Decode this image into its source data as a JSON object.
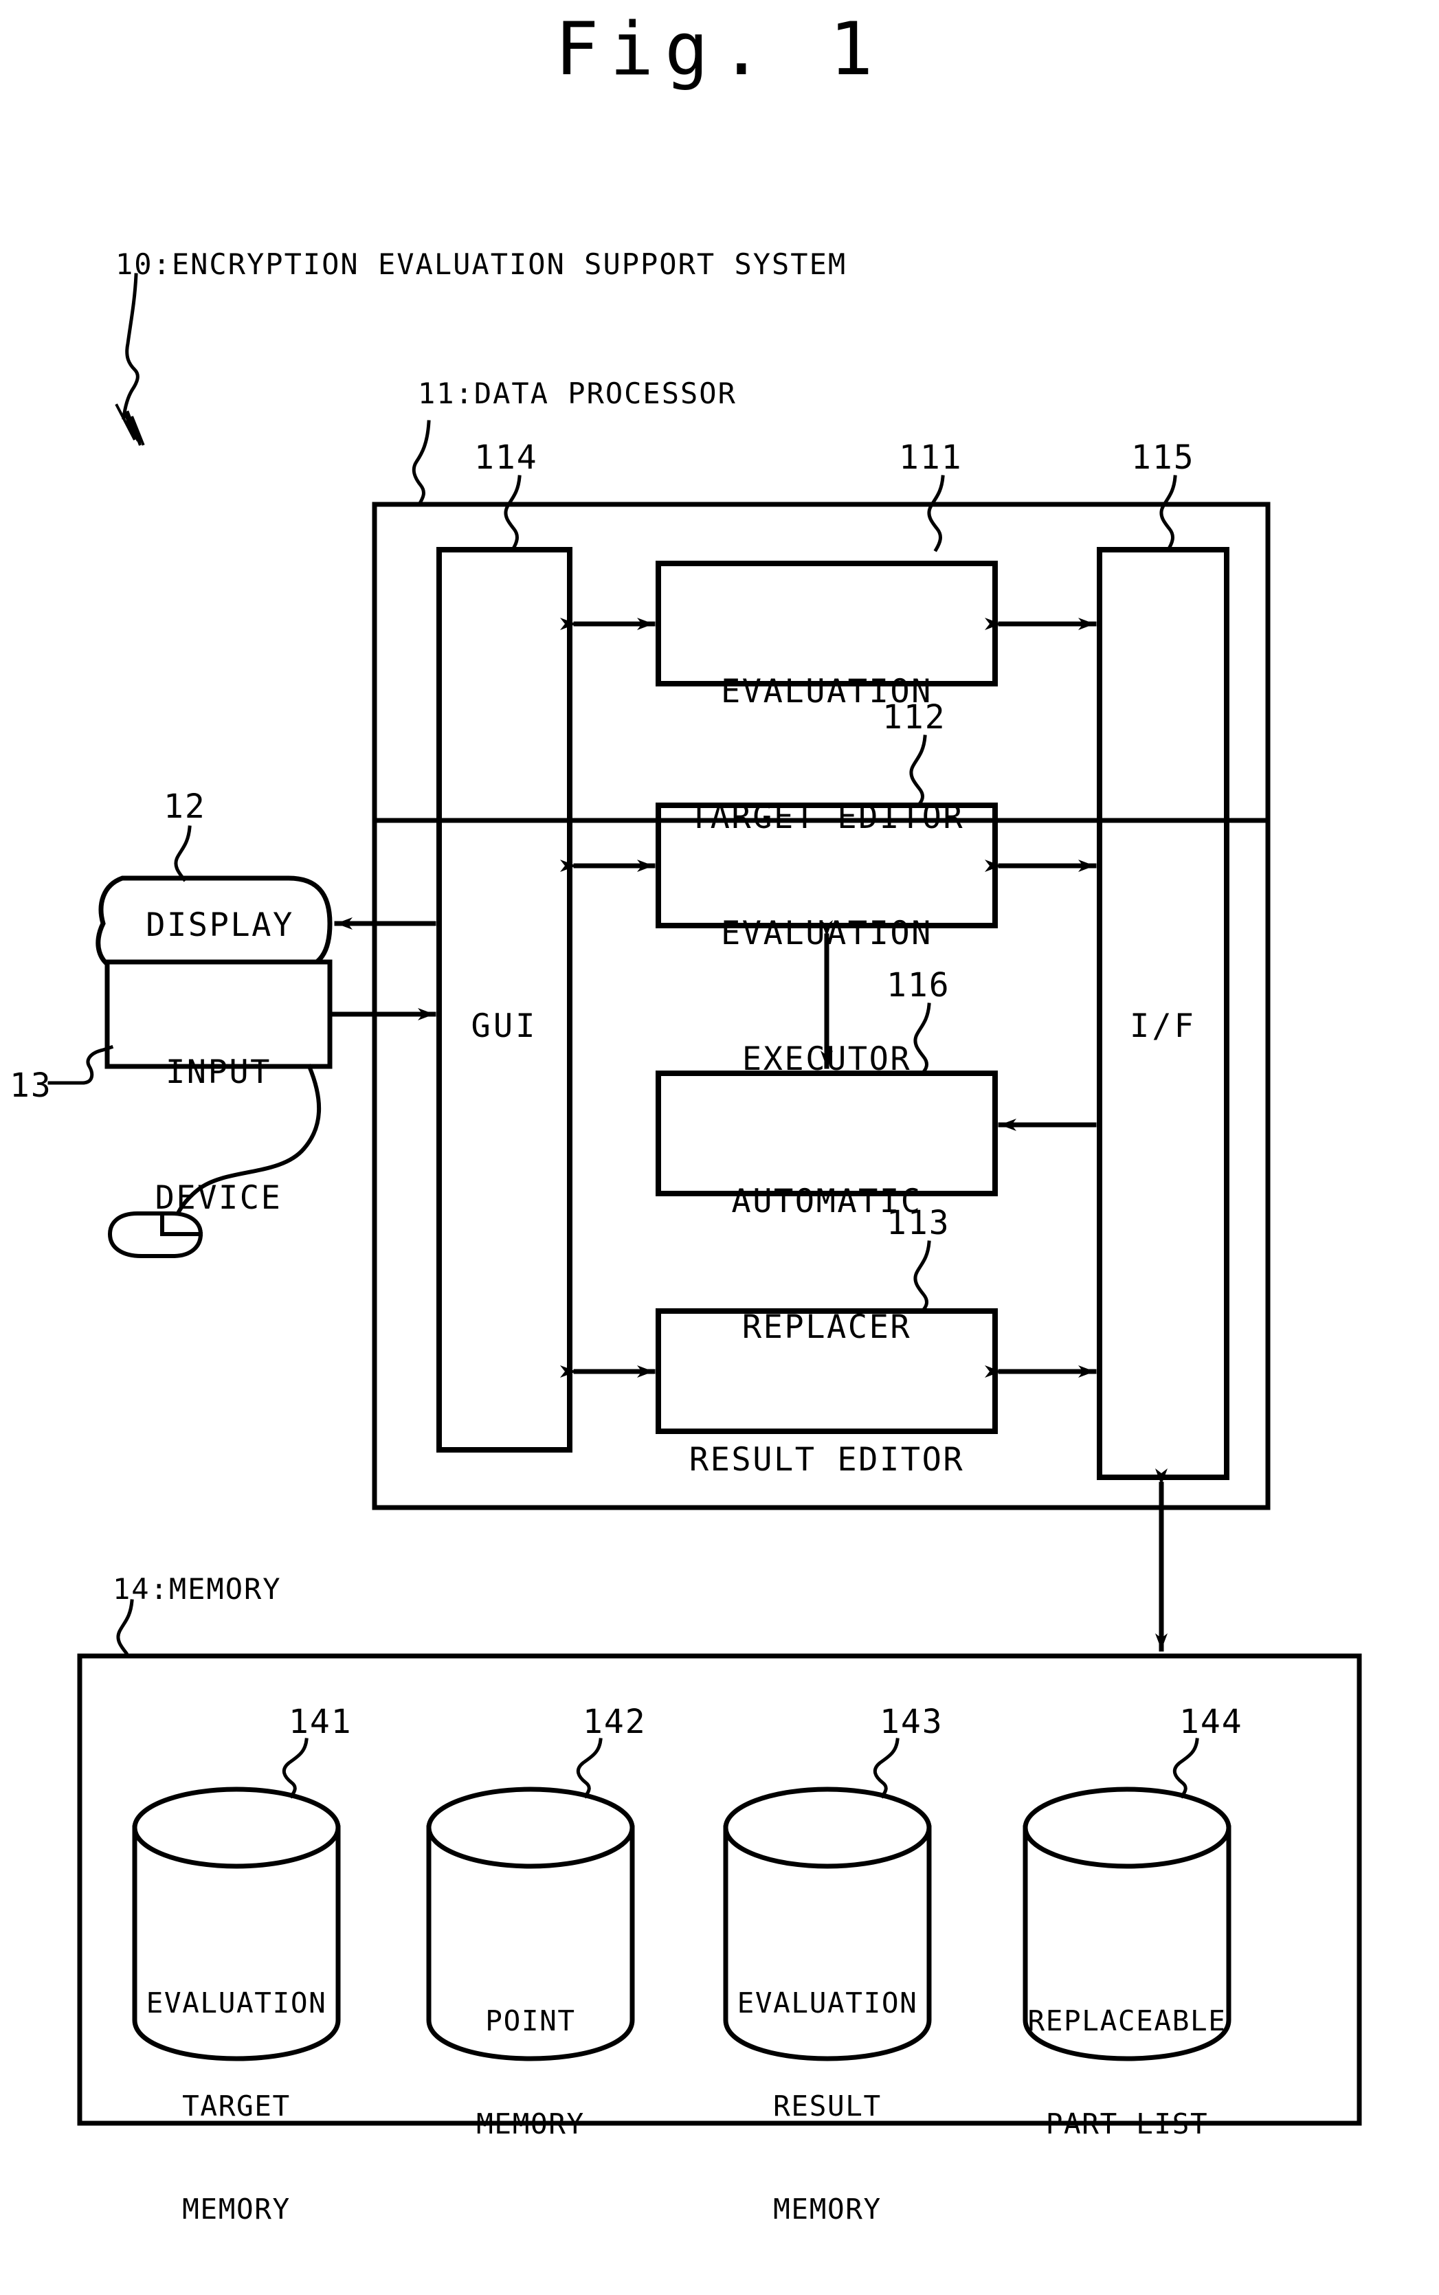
{
  "figure": {
    "title": "Fig. 1"
  },
  "callouts": {
    "system": "10:ENCRYPTION EVALUATION SUPPORT SYSTEM",
    "data_processor": "11:DATA PROCESSOR",
    "memory": "14:MEMORY"
  },
  "refnums": {
    "gui": "114",
    "evaluation_target_editor": "111",
    "interface": "115",
    "evaluation_executor": "112",
    "automatic_replacer": "116",
    "result_editor": "113",
    "display": "12",
    "input_device": "13",
    "evaluation_target_memory": "141",
    "point_memory": "142",
    "evaluation_result_memory": "143",
    "replaceable_part_list": "144"
  },
  "data_processor": {
    "gui_label": "GUI",
    "interface_label": "I/F",
    "modules": [
      {
        "id": "evaluation-target-editor",
        "line1": "EVALUATION",
        "line2": "TARGET EDITOR"
      },
      {
        "id": "evaluation-executor",
        "line1": "EVALUATION",
        "line2": "EXECUTOR"
      },
      {
        "id": "automatic-replacer",
        "line1": "AUTOMATIC",
        "line2": "REPLACER"
      },
      {
        "id": "result-editor",
        "line1": "RESULT EDITOR",
        "line2": ""
      }
    ]
  },
  "peripherals": {
    "display_label": "DISPLAY",
    "input_device_line1": "INPUT",
    "input_device_line2": "DEVICE"
  },
  "memory": {
    "stores": [
      {
        "id": "evaluation-target-memory",
        "line1": "EVALUATION",
        "line2": "TARGET",
        "line3": "MEMORY"
      },
      {
        "id": "point-memory",
        "line1": "POINT",
        "line2": "MEMORY",
        "line3": ""
      },
      {
        "id": "evaluation-result-memory",
        "line1": "EVALUATION",
        "line2": "RESULT",
        "line3": "MEMORY"
      },
      {
        "id": "replaceable-part-list",
        "line1": "REPLACEABLE",
        "line2": "PART LIST",
        "line3": ""
      }
    ]
  },
  "colors": {
    "ink": "#000000",
    "paper": "#ffffff"
  }
}
